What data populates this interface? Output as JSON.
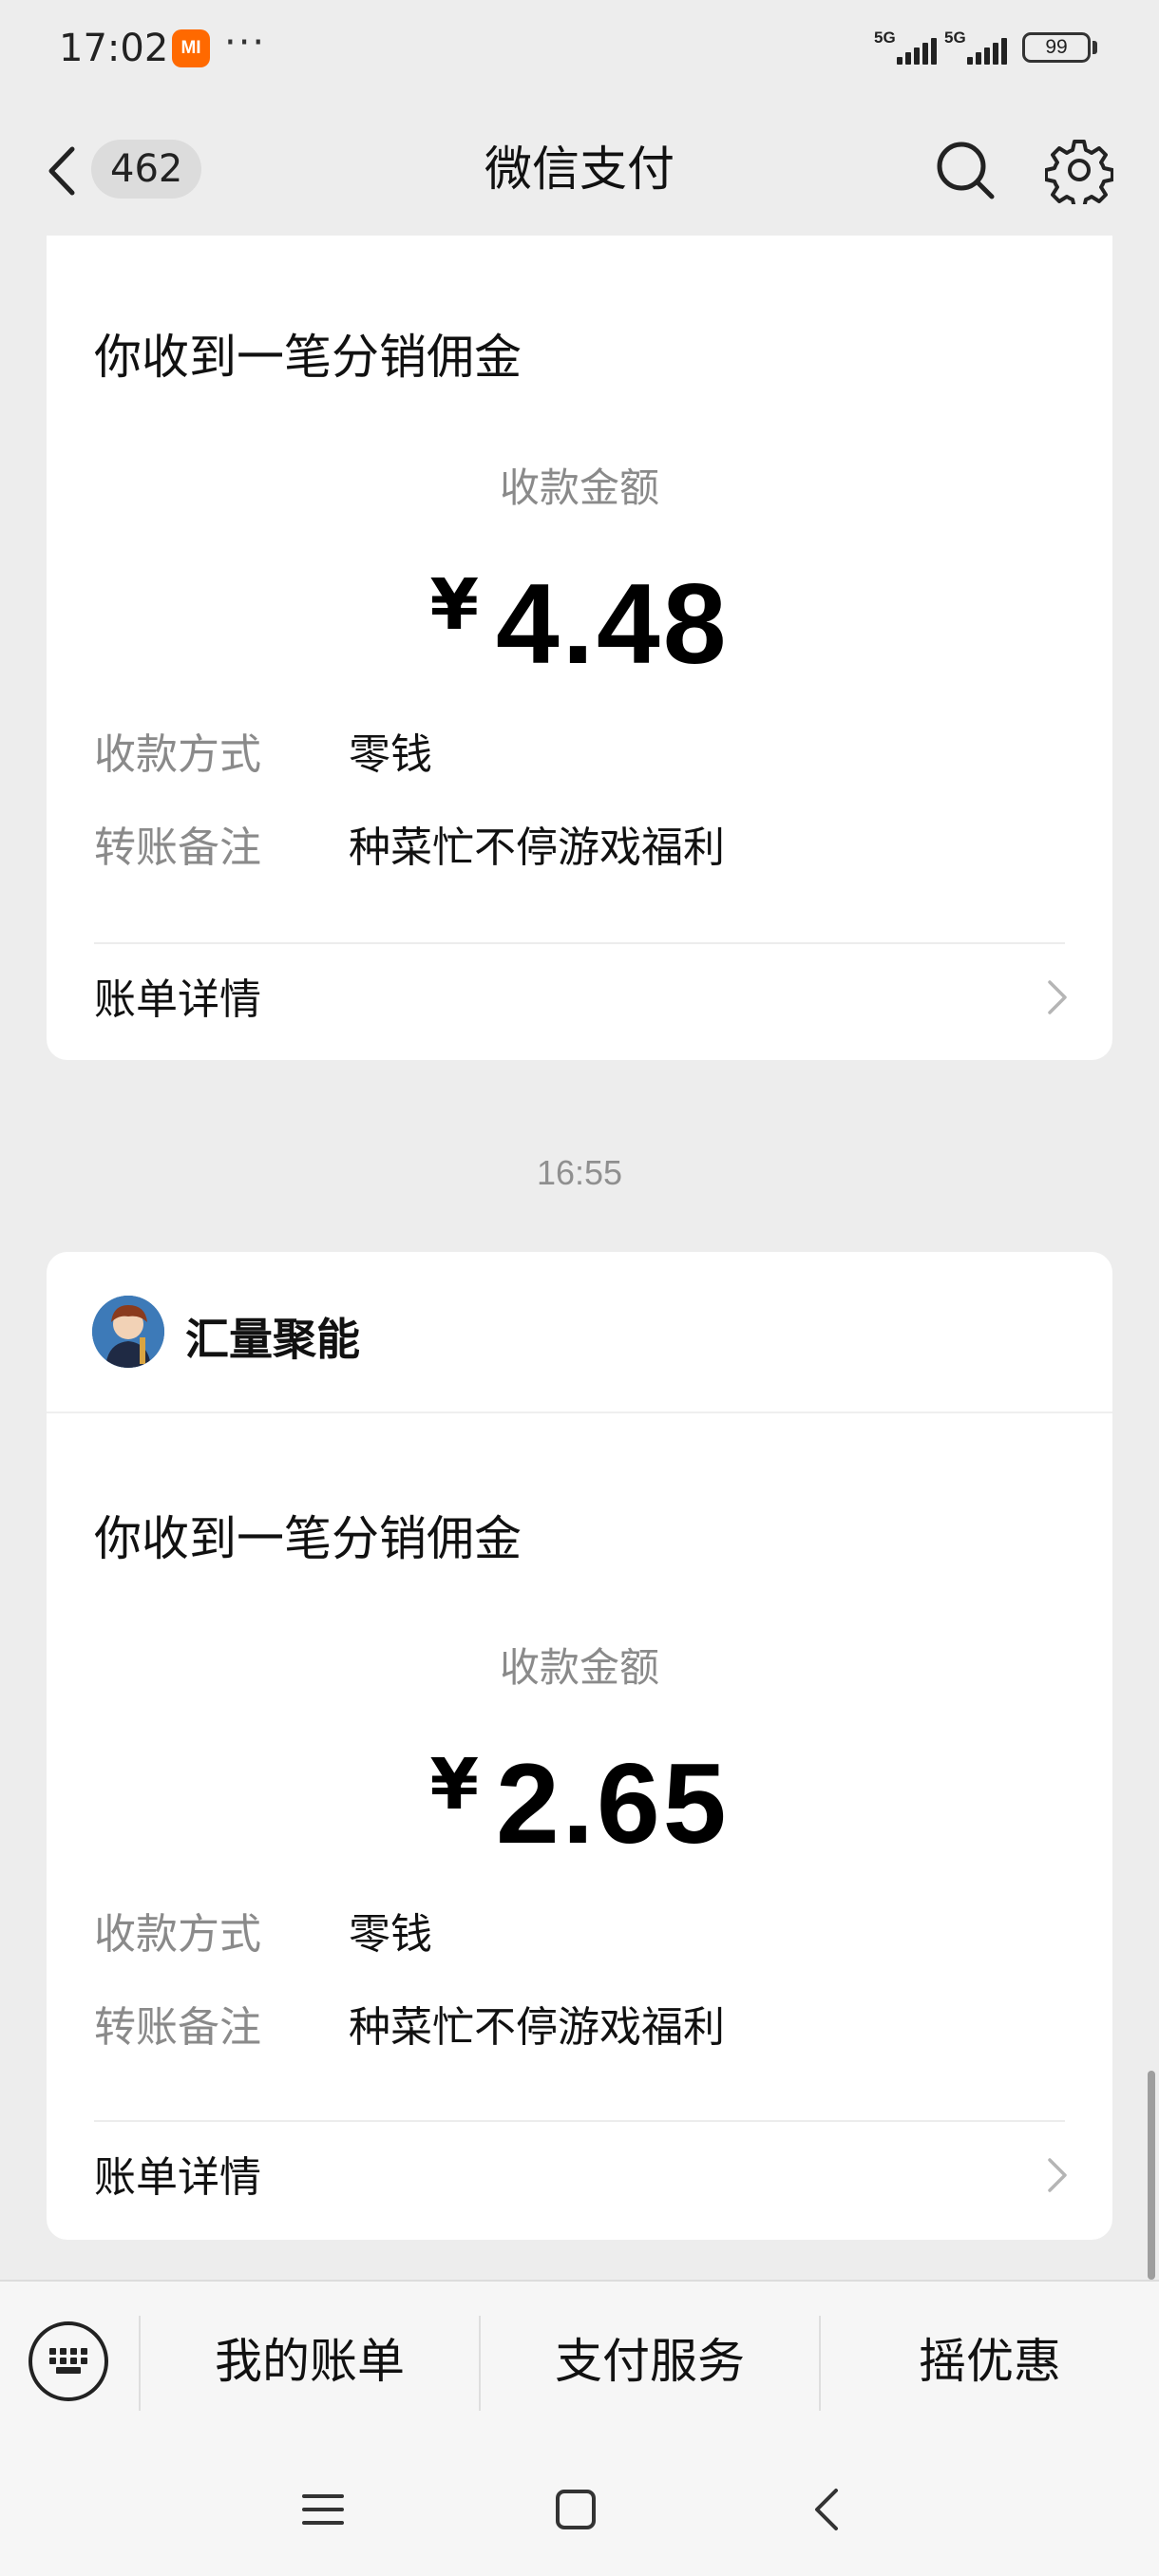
{
  "status_bar": {
    "time": "17:02",
    "brand_icon": "MI",
    "overflow": "···",
    "network_1": "5G",
    "network_2": "5G",
    "battery": "99"
  },
  "nav": {
    "unread_count": "462",
    "title": "微信支付",
    "icons": [
      "back-icon",
      "search-icon",
      "gear-icon"
    ]
  },
  "messages": [
    {
      "title": "你收到一笔分销佣金",
      "amount_label": "收款金额",
      "currency": "¥",
      "amount": "4.48",
      "fields": [
        {
          "key": "收款方式",
          "value": "零钱"
        },
        {
          "key": "转账备注",
          "value": "种菜忙不停游戏福利"
        }
      ],
      "detail_link": "账单详情"
    },
    {
      "timestamp": "16:55",
      "sender": "汇量聚能",
      "title": "你收到一笔分销佣金",
      "amount_label": "收款金额",
      "currency": "¥",
      "amount": "2.65",
      "fields": [
        {
          "key": "收款方式",
          "value": "零钱"
        },
        {
          "key": "转账备注",
          "value": "种菜忙不停游戏福利"
        }
      ],
      "detail_link": "账单详情"
    }
  ],
  "bottom_menu": {
    "items": [
      "我的账单",
      "支付服务",
      "摇优惠"
    ]
  },
  "colors": {
    "background": "#ededed",
    "card": "#ffffff",
    "secondary_text": "#8a8a8a"
  }
}
